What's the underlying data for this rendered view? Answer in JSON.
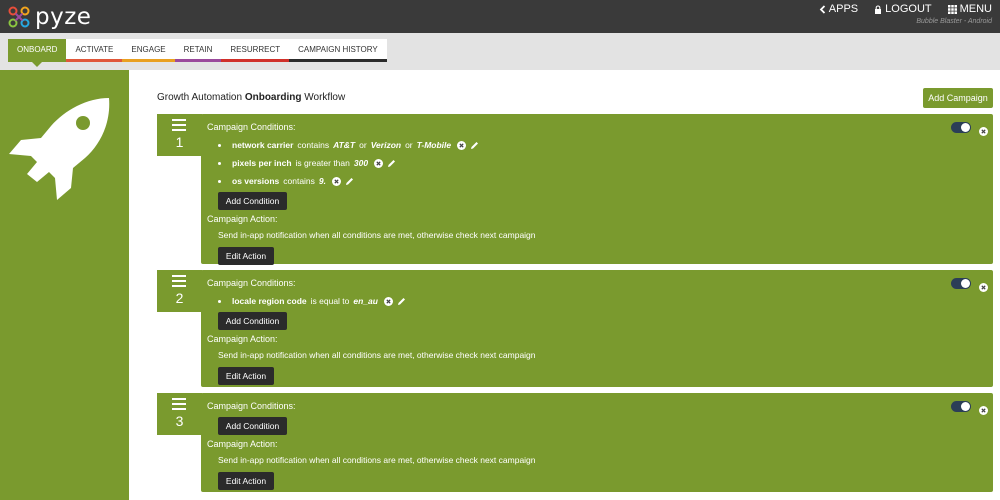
{
  "topbar": {
    "logo_text": "pyze",
    "apps_label": "APPS",
    "logout_label": "LOGOUT",
    "menu_label": "MENU",
    "app_subtitle": "Bubble Blaster - Android"
  },
  "tabs": [
    {
      "label": "ONBOARD",
      "color": "#7a9a2e",
      "active": true
    },
    {
      "label": "ACTIVATE",
      "color": "#e0573a"
    },
    {
      "label": "ENGAGE",
      "color": "#e9a020"
    },
    {
      "label": "RETAIN",
      "color": "#9b4a9c"
    },
    {
      "label": "RESURRECT",
      "color": "#d0302a"
    },
    {
      "label": "CAMPAIGN HISTORY",
      "color": "#2b2b2b"
    }
  ],
  "main": {
    "title_prefix": "Growth Automation",
    "title_bold": "Onboarding",
    "title_suffix": "Workflow",
    "add_campaign_label": "Add Campaign"
  },
  "common": {
    "conditions_label": "Campaign Conditions:",
    "action_label": "Campaign Action:",
    "add_condition_label": "Add Condition",
    "edit_action_label": "Edit Action",
    "action_text": "Send in-app notification when all conditions are met, otherwise check next campaign"
  },
  "campaigns": [
    {
      "number": "1",
      "conditions": [
        {
          "field": "network carrier",
          "op": "contains",
          "values": [
            "AT&T",
            "Verizon",
            "T-Mobile"
          ],
          "joiner": "or"
        },
        {
          "field": "pixels per inch",
          "op": "is greater than",
          "values": [
            "300"
          ]
        },
        {
          "field": "os versions",
          "op": "contains",
          "values": [
            "9."
          ]
        }
      ]
    },
    {
      "number": "2",
      "conditions": [
        {
          "field": "locale region code",
          "op": "is equal to",
          "values": [
            "en_au"
          ]
        }
      ]
    },
    {
      "number": "3",
      "conditions": []
    }
  ],
  "colors": {
    "brand_green": "#7a9a2e",
    "topbar": "#3a3a3a",
    "dark_button": "#2b2b2b",
    "toggle": "#2b3e57"
  }
}
